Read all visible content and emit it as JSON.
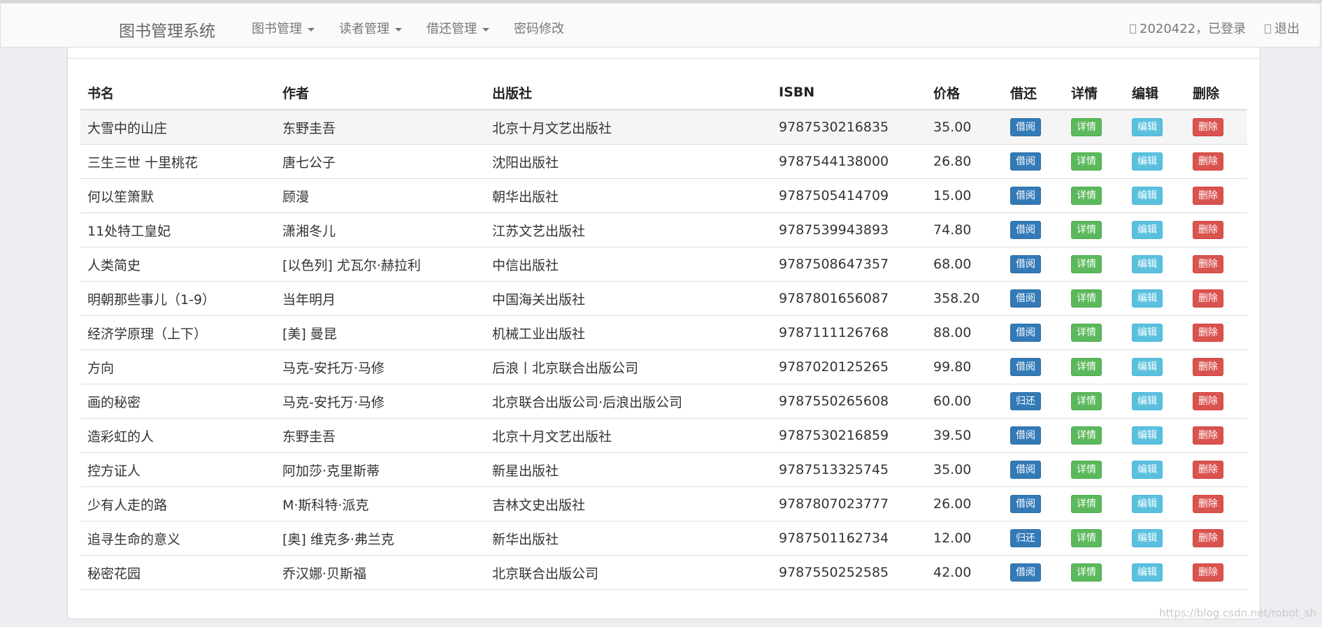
{
  "navbar": {
    "brand": "图书管理系统",
    "menu": [
      {
        "label": "图书管理",
        "dropdown": true
      },
      {
        "label": "读者管理",
        "dropdown": true
      },
      {
        "label": "借还管理",
        "dropdown": true
      },
      {
        "label": "密码修改",
        "dropdown": false
      }
    ],
    "user_status": "2020422，已登录",
    "logout": "退出"
  },
  "table": {
    "headers": [
      "书名",
      "作者",
      "出版社",
      "ISBN",
      "价格",
      "借还",
      "详情",
      "编辑",
      "删除"
    ],
    "detail_label": "详情",
    "edit_label": "编辑",
    "delete_label": "删除",
    "rows": [
      {
        "title": "大雪中的山庄",
        "author": "东野圭吾",
        "publisher": "北京十月文艺出版社",
        "isbn": "9787530216835",
        "price": "35.00",
        "action": "借阅"
      },
      {
        "title": "三生三世 十里桃花",
        "author": "唐七公子",
        "publisher": "沈阳出版社",
        "isbn": "9787544138000",
        "price": "26.80",
        "action": "借阅"
      },
      {
        "title": "何以笙箫默",
        "author": "顾漫",
        "publisher": "朝华出版社",
        "isbn": "9787505414709",
        "price": "15.00",
        "action": "借阅"
      },
      {
        "title": "11处特工皇妃",
        "author": "潇湘冬儿",
        "publisher": "江苏文艺出版社",
        "isbn": "9787539943893",
        "price": "74.80",
        "action": "借阅"
      },
      {
        "title": "人类简史",
        "author": "[以色列] 尤瓦尔·赫拉利",
        "publisher": "中信出版社",
        "isbn": "9787508647357",
        "price": "68.00",
        "action": "借阅"
      },
      {
        "title": "明朝那些事儿（1-9）",
        "author": "当年明月",
        "publisher": "中国海关出版社",
        "isbn": "9787801656087",
        "price": "358.20",
        "action": "借阅"
      },
      {
        "title": "经济学原理（上下）",
        "author": "[美] 曼昆",
        "publisher": "机械工业出版社",
        "isbn": "9787111126768",
        "price": "88.00",
        "action": "借阅"
      },
      {
        "title": "方向",
        "author": "马克-安托万·马修",
        "publisher": "后浪丨北京联合出版公司",
        "isbn": "9787020125265",
        "price": "99.80",
        "action": "借阅"
      },
      {
        "title": "画的秘密",
        "author": "马克-安托万·马修",
        "publisher": "北京联合出版公司·后浪出版公司",
        "isbn": "9787550265608",
        "price": "60.00",
        "action": "归还"
      },
      {
        "title": "造彩虹的人",
        "author": "东野圭吾",
        "publisher": "北京十月文艺出版社",
        "isbn": "9787530216859",
        "price": "39.50",
        "action": "借阅"
      },
      {
        "title": "控方证人",
        "author": "阿加莎·克里斯蒂",
        "publisher": "新星出版社",
        "isbn": "9787513325745",
        "price": "35.00",
        "action": "借阅"
      },
      {
        "title": "少有人走的路",
        "author": "M·斯科特·派克",
        "publisher": "吉林文史出版社",
        "isbn": "9787807023777",
        "price": "26.00",
        "action": "借阅"
      },
      {
        "title": "追寻生命的意义",
        "author": "[奥] 维克多·弗兰克",
        "publisher": "新华出版社",
        "isbn": "9787501162734",
        "price": "12.00",
        "action": "归还"
      },
      {
        "title": "秘密花园",
        "author": "乔汉娜·贝斯福",
        "publisher": "北京联合出版公司",
        "isbn": "9787550252585",
        "price": "42.00",
        "action": "借阅"
      }
    ]
  },
  "watermark": "https://blog.csdn.net/robot_sh",
  "colors": {
    "primary": "#337ab7",
    "success": "#5cb85c",
    "info": "#5bc0de",
    "danger": "#d9534f"
  }
}
